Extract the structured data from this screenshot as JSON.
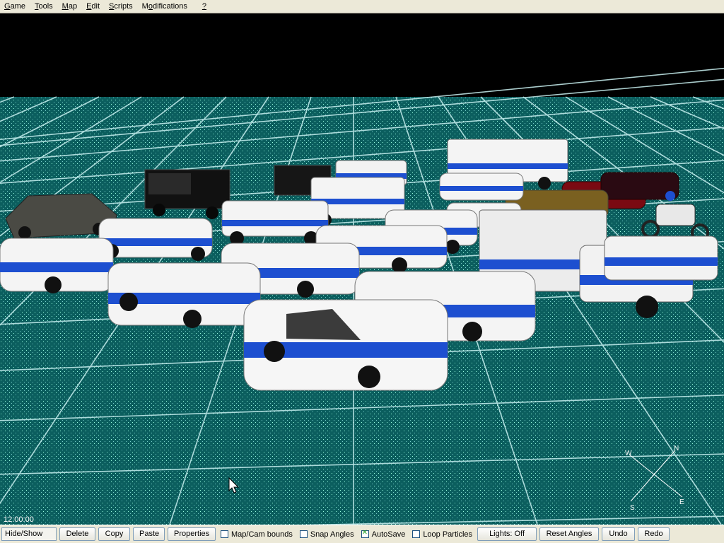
{
  "menu": [
    {
      "pre": "",
      "ul": "G",
      "post": "ame"
    },
    {
      "pre": "",
      "ul": "T",
      "post": "ools"
    },
    {
      "pre": "",
      "ul": "M",
      "post": "ap"
    },
    {
      "pre": "",
      "ul": "E",
      "post": "dit"
    },
    {
      "pre": "",
      "ul": "S",
      "post": "cripts"
    },
    {
      "pre": "M",
      "ul": "o",
      "post": "difications"
    },
    {
      "pre": "",
      "ul": "?",
      "post": ""
    }
  ],
  "viewport": {
    "time": "12:00:00",
    "compass": {
      "n": "N",
      "e": "E",
      "s": "S",
      "w": "W"
    },
    "colors": {
      "grid_bg": "#0b5e5e",
      "grid_line": "#c8f0f0",
      "police_blue": "#1d4fd0"
    }
  },
  "toolbar": {
    "hide_show": "Hide/Show",
    "delete": "Delete",
    "copy": "Copy",
    "paste": "Paste",
    "properties": "Properties",
    "map_cam_bounds": {
      "label": "Map/Cam bounds",
      "checked": false
    },
    "snap_angles": {
      "label": "Snap Angles",
      "checked": false
    },
    "autosave": {
      "label": "AutoSave",
      "checked": true
    },
    "loop_particles": {
      "label": "Loop Particles",
      "checked": false
    },
    "lights": "Lights: Off",
    "reset_angles": "Reset Angles",
    "undo": "Undo",
    "redo": "Redo"
  }
}
